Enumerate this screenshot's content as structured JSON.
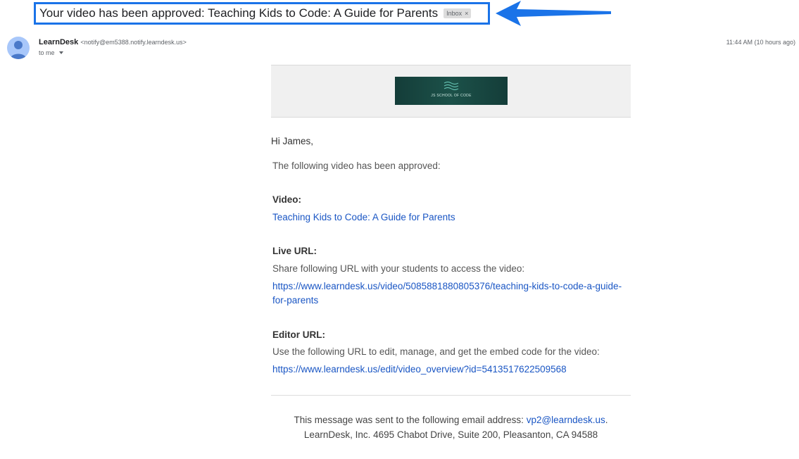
{
  "subject": {
    "title": "Your video has been approved: Teaching Kids to Code: A Guide for Parents",
    "label_chip": "Inbox",
    "chip_close": "×"
  },
  "sender": {
    "name": "LearnDesk",
    "email": "<notify@em5388.notify.learndesk.us>",
    "recipient": "to me",
    "timestamp": "11:44 AM (10 hours ago)"
  },
  "banner": {
    "logo_text": "JS SCHOOL OF CODE"
  },
  "body": {
    "greeting": "Hi James,",
    "intro": "The following video has been approved:",
    "video_label": "Video:",
    "video_title": "Teaching Kids to Code: A Guide for Parents",
    "live_label": "Live URL:",
    "live_desc": "Share following URL with your students to access the video:",
    "live_url_line1": "https://www.learndesk.us/video/5085881880805376/teaching-kids-to-code-a-guide-",
    "live_url_line2": "for-parents",
    "editor_label": "Editor URL:",
    "editor_desc": "Use the following URL to edit, manage, and get the embed code for the video:",
    "editor_url": "https://www.learndesk.us/edit/video_overview?id=5413517622509568"
  },
  "footer": {
    "sent_to_prefix": "This message was sent to the following email address: ",
    "sent_to_email": "vp2@learndesk.us",
    "sent_to_suffix": ".",
    "address": "LearnDesk, Inc. 4695 Chabot Drive, Suite 200, Pleasanton, CA 94588"
  },
  "colors": {
    "highlight_border": "#1a73e8",
    "arrow": "#1a73e8",
    "link": "#1a56c4",
    "logo_bg": "#143d39"
  }
}
